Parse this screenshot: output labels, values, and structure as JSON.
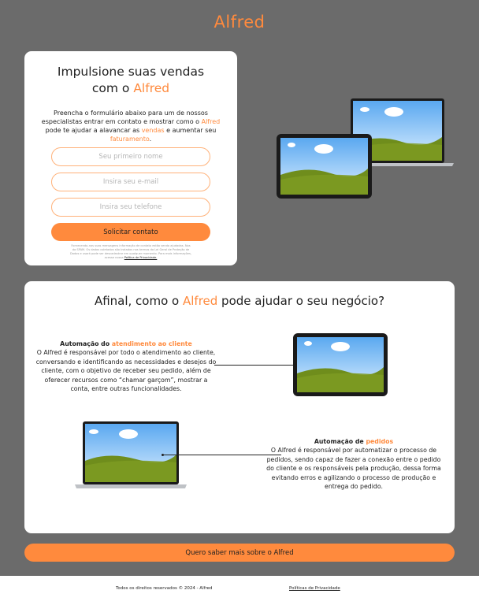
{
  "brand": {
    "name": "Alfred",
    "accent": "#ff8a3d"
  },
  "form": {
    "title_line1": "Impulsione suas vendas",
    "title_line2_prefix": "com o ",
    "title_line2_accent": "Alfred",
    "desc_part1": "Preencha o formulário abaixo para um de nossos especialistas entrar em contato e mostrar como o ",
    "desc_accent1": "Alfred",
    "desc_part2": " pode te ajudar a alavancar as ",
    "desc_accent2": "vendas",
    "desc_part3": " e aumentar seu ",
    "desc_accent3": "faturamento",
    "desc_part4": ".",
    "name_placeholder": "Seu primeiro nome",
    "email_placeholder": "Insira seu e-mail",
    "phone_placeholder": "Insira seu telefone",
    "submit_label": "Solicitar contato",
    "disclaimer_text": "Fornecendo-nos suas mensagens informação de contato estão sendo ajudadas. Nos da SPAM. Os dados coletados são tratados nos termos da Lei Geral de Proteção de Dados e usará pode ser descadastrar em qualquer momento. Para mais informações, acesse nossa",
    "disclaimer_link": "Política de Privacidade."
  },
  "help": {
    "title_prefix": "Afinal, como o ",
    "title_accent": "Alfred",
    "title_suffix": " pode ajudar o seu negócio?",
    "feature1": {
      "title_prefix": "Automação do ",
      "title_accent": "atendimento ao cliente",
      "text": "O Alfred é responsável por todo o atendimento ao cliente, conversando e identificando as necessidades e desejos do cliente, com o objetivo de receber seu pedido, além de oferecer recursos como “chamar garçom”, mostrar a conta, entre outras funcionalidades."
    },
    "feature2": {
      "title_prefix": "Automação de ",
      "title_accent": "pedidos",
      "text": "O Alfred é responsável por automatizar o processo de pedidos, sendo capaz de fazer a conexão entre o pedido do cliente e os responsáveis pela produção, dessa forma evitando erros e agilizando o processo de produção e entrega do pedido."
    }
  },
  "cta_label": "Quero saber mais sobre o Alfred",
  "footer": {
    "copyright": "Todos os direitos reservados © 2024 - Alfred",
    "privacy_link": "Políticas de Privacidade"
  }
}
